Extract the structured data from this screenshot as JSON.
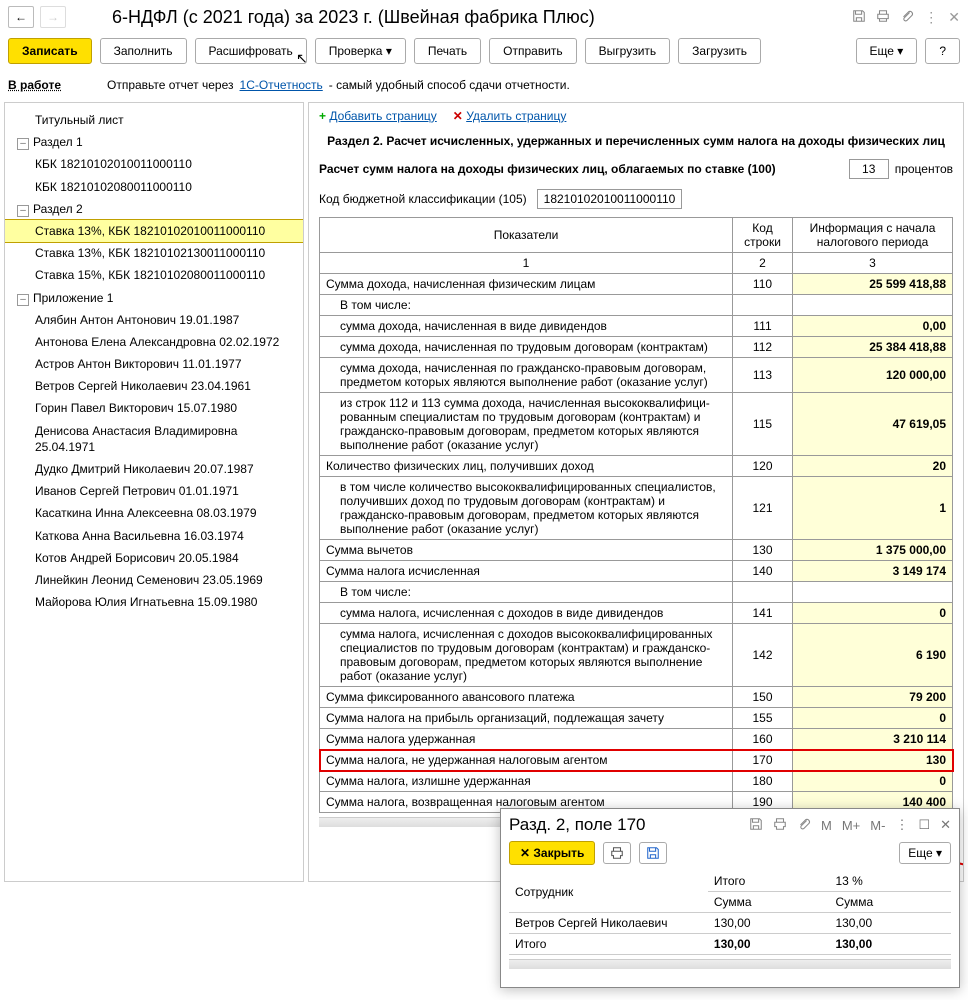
{
  "window": {
    "title": "6-НДФЛ (с 2021 года) за 2023 г. (Швейная фабрика Плюс)"
  },
  "toolbar": {
    "zapisat": "Записать",
    "zapolnit": "Заполнить",
    "rasshifrovat": "Расшифровать",
    "proverka": "Проверка",
    "pechat": "Печать",
    "otpravit": "Отправить",
    "vygruzit": "Выгрузить",
    "zagruzit": "Загрузить",
    "eshche": "Еще",
    "help": "?"
  },
  "status": {
    "label": "В работе",
    "msg_left": "Отправьте отчет через",
    "link": "1С-Отчетность",
    "msg_right": " - самый удобный способ сдачи отчетности."
  },
  "tree": {
    "items": [
      {
        "lvl": 0,
        "text": "Титульный лист"
      },
      {
        "lvl": 0,
        "text": "Раздел 1",
        "toggle": "-"
      },
      {
        "lvl": 1,
        "text": "КБК 18210102010011000110"
      },
      {
        "lvl": 1,
        "text": "КБК 18210102080011000110"
      },
      {
        "lvl": 0,
        "text": "Раздел 2",
        "toggle": "-"
      },
      {
        "lvl": 1,
        "text": "Ставка 13%, КБК 18210102010011000110",
        "sel": true
      },
      {
        "lvl": 1,
        "text": "Ставка 13%, КБК 18210102130011000110"
      },
      {
        "lvl": 1,
        "text": "Ставка 15%, КБК 18210102080011000110"
      },
      {
        "lvl": 0,
        "text": "Приложение 1",
        "toggle": "-"
      },
      {
        "lvl": 1,
        "text": "Алябин Антон Антонович 19.01.1987"
      },
      {
        "lvl": 1,
        "text": "Антонова Елена Александровна 02.02.1972"
      },
      {
        "lvl": 1,
        "text": "Астров Антон Викторович 11.01.1977"
      },
      {
        "lvl": 1,
        "text": "Ветров Сергей Николаевич 23.04.1961"
      },
      {
        "lvl": 1,
        "text": "Горин Павел Викторович 15.07.1980"
      },
      {
        "lvl": 1,
        "text": "Денисова Анастасия Владимировна 25.04.1971"
      },
      {
        "lvl": 1,
        "text": "Дудко Дмитрий Николаевич 20.07.1987"
      },
      {
        "lvl": 1,
        "text": "Иванов Сергей Петрович 01.01.1971"
      },
      {
        "lvl": 1,
        "text": "Касаткина Инна Алексеевна 08.03.1979"
      },
      {
        "lvl": 1,
        "text": "Каткова Анна Васильевна 16.03.1974"
      },
      {
        "lvl": 1,
        "text": "Котов Андрей Борисович 20.05.1984"
      },
      {
        "lvl": 1,
        "text": "Линейкин Леонид Семенович 23.05.1969"
      },
      {
        "lvl": 1,
        "text": "Майорова Юлия Игнатьевна 15.09.1980"
      }
    ]
  },
  "page_actions": {
    "add": "Добавить страницу",
    "del": "Удалить страницу"
  },
  "section": {
    "title": "Раздел 2. Расчет исчисленных, удержанных и перечисленных сумм налога на доходы физических лиц",
    "rate_text": "Расчет сумм налога на доходы физических лиц, облагаемых по ставке  (100)",
    "rate_value": "13",
    "rate_unit": "процентов",
    "kbk_label": "Код бюджетной классификации  (105)",
    "kbk_value": "18210102010011000110"
  },
  "table": {
    "headers": {
      "ind": "Показатели",
      "code": "Код строки",
      "val": "Информация с начала налогового периода",
      "n1": "1",
      "n2": "2",
      "n3": "3"
    },
    "rows": [
      {
        "ind": "Сумма дохода, начисленная физическим лицам",
        "code": "110",
        "val": "25 599 418,88"
      },
      {
        "ind": "В том числе:",
        "code": "",
        "val": "",
        "sub": true,
        "novalborder": true
      },
      {
        "ind": "сумма дохода, начисленная в виде дивидендов",
        "code": "111",
        "val": "0,00",
        "sub": true
      },
      {
        "ind": "сумма дохода, начисленная по трудовым договорам (контрактам)",
        "code": "112",
        "val": "25 384 418,88",
        "sub": true
      },
      {
        "ind": "сумма дохода, начисленная по гражданско-правовым договорам, предметом которых являются выполнение работ (оказание услуг)",
        "code": "113",
        "val": "120 000,00",
        "sub": true
      },
      {
        "ind": "из строк 112 и 113 сумма дохода, начисленная высококвалифици-рованным специалистам по трудовым договорам (контрактам) и гражданско-правовым договорам, предметом которых являются выполнение работ (оказание услуг)",
        "code": "115",
        "val": "47 619,05",
        "sub": true
      },
      {
        "ind": "Количество физических лиц, получивших доход",
        "code": "120",
        "val": "20"
      },
      {
        "ind": "в том числе количество высококвалифицированных специалистов, получивших доход по трудовым договорам (контрактам) и гражданско-правовым договорам, предметом которых являются выполнение работ (оказание услуг)",
        "code": "121",
        "val": "1",
        "sub": true
      },
      {
        "ind": "Сумма вычетов",
        "code": "130",
        "val": "1 375 000,00"
      },
      {
        "ind": "Сумма налога исчисленная",
        "code": "140",
        "val": "3 149 174"
      },
      {
        "ind": "В том числе:",
        "code": "",
        "val": "",
        "sub": true,
        "novalborder": true
      },
      {
        "ind": "сумма налога, исчисленная с доходов в виде дивидендов",
        "code": "141",
        "val": "0",
        "sub": true
      },
      {
        "ind": "сумма налога, исчисленная с доходов высококвалифицированных специалистов по трудовым договорам (контрактам) и гражданско-правовым договорам, предметом которых являются выполнение работ (оказание услуг)",
        "code": "142",
        "val": "6 190",
        "sub": true
      },
      {
        "ind": "Сумма фиксированного авансового платежа",
        "code": "150",
        "val": "79 200"
      },
      {
        "ind": "Сумма налога на прибыль организаций, подлежащая зачету",
        "code": "155",
        "val": "0"
      },
      {
        "ind": "Сумма налога удержанная",
        "code": "160",
        "val": "3 210 114"
      },
      {
        "ind": "Сумма налога, не удержанная налоговым агентом",
        "code": "170",
        "val": "130",
        "hl": true
      },
      {
        "ind": "Сумма налога, излишне удержанная",
        "code": "180",
        "val": "0"
      },
      {
        "ind": "Сумма налога, возвращенная налоговым агентом",
        "code": "190",
        "val": "140 400"
      }
    ]
  },
  "popup": {
    "title": "Разд. 2, поле 170",
    "close": "Закрыть",
    "eshche": "Еще",
    "headers": {
      "emp": "Сотрудник",
      "itog": "Итого",
      "pct": "13 %",
      "sum": "Сумма",
      "sum2": "Сумма"
    },
    "row": {
      "emp": "Ветров Сергей Николаевич",
      "v1": "130,00",
      "v2": "130,00"
    },
    "total": {
      "label": "Итого",
      "v1": "130,00",
      "v2": "130,00"
    }
  }
}
